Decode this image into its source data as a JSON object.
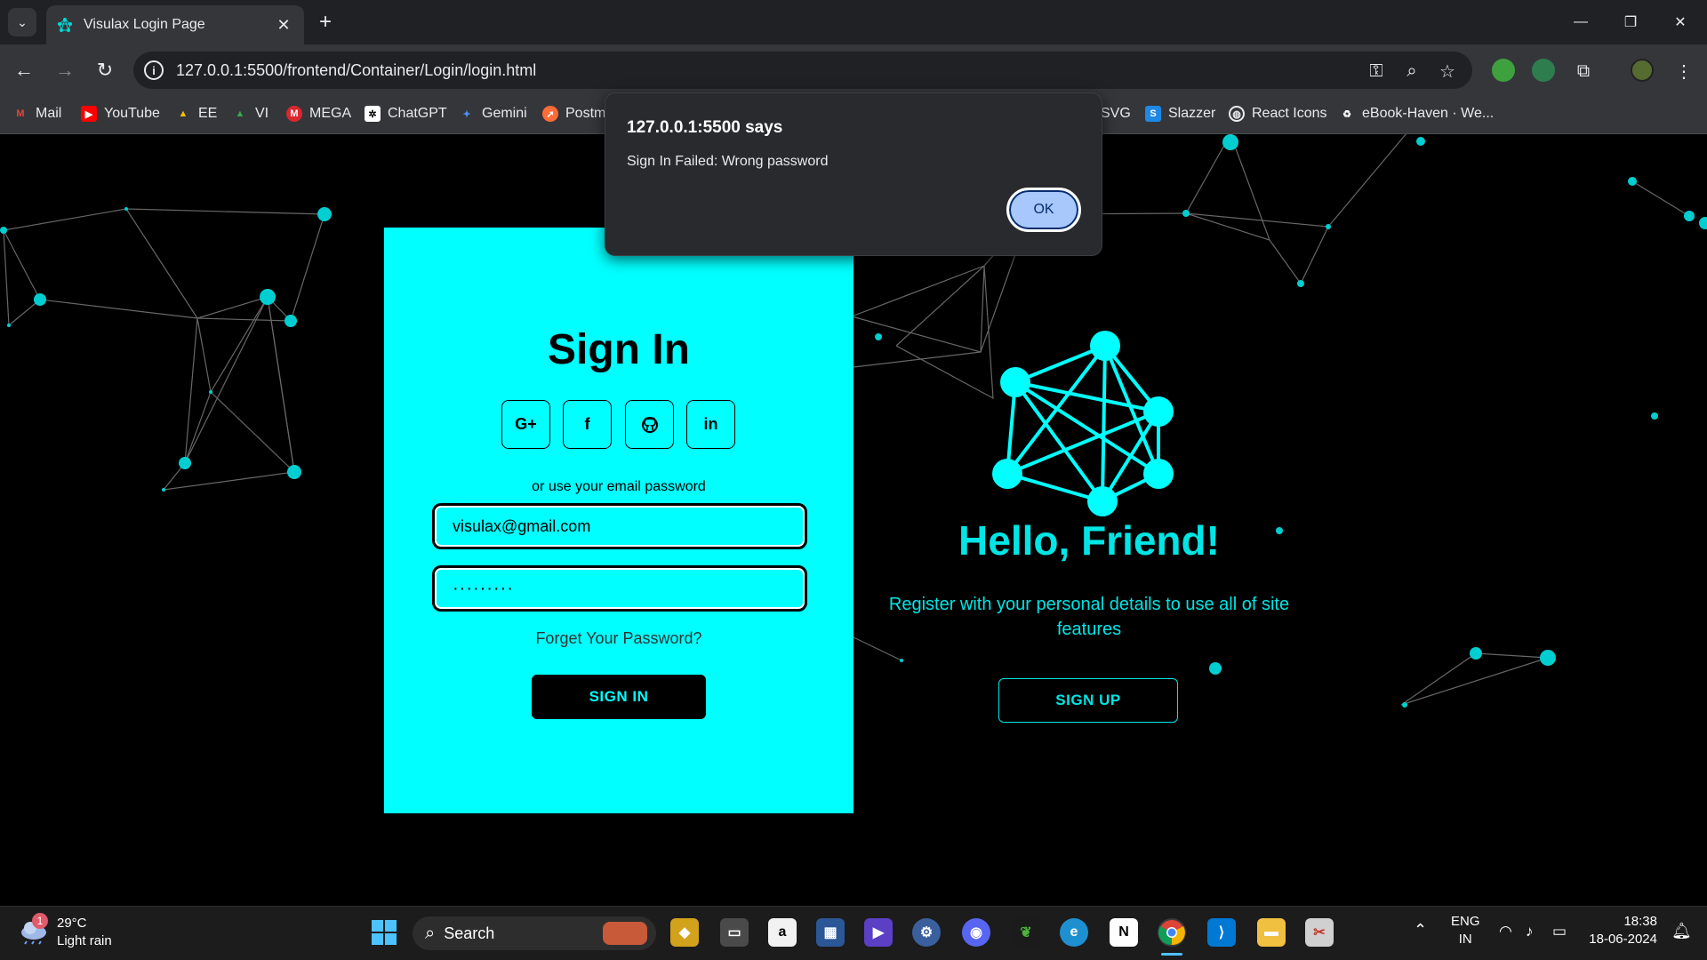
{
  "browser": {
    "tab_title": "Visulax Login Page",
    "url": "127.0.0.1:5500/frontend/Container/Login/login.html",
    "bookmarks": [
      "Mail",
      "YouTube",
      "EE",
      "VI",
      "MEGA",
      "ChatGPT",
      "Gemini",
      "Postm",
      "SVG",
      "Slazzer",
      "React Icons",
      "eBook-Haven · We..."
    ]
  },
  "dialog": {
    "title": "127.0.0.1:5500 says",
    "message": "Sign In Failed: Wrong password",
    "ok_label": "OK"
  },
  "signin": {
    "title": "Sign In",
    "social": [
      "G+",
      "f",
      "github",
      "in"
    ],
    "or_text": "or use your email password",
    "email_value": "visulax@gmail.com",
    "password_value": "·········",
    "forgot": "Forget Your Password?",
    "button": "SIGN IN"
  },
  "signup": {
    "title": "Hello, Friend!",
    "text": "Register with your personal details to use all of site features",
    "button": "SIGN UP"
  },
  "taskbar": {
    "weather_temp": "29°C",
    "weather_desc": "Light rain",
    "weather_badge": "1",
    "search": "Search",
    "lang": "ENG",
    "region": "IN",
    "time": "18:38",
    "date": "18-06-2024"
  },
  "colors": {
    "accent": "#00ffff",
    "dialog_button": "#a8c7fa",
    "page_bg": "#000000"
  }
}
